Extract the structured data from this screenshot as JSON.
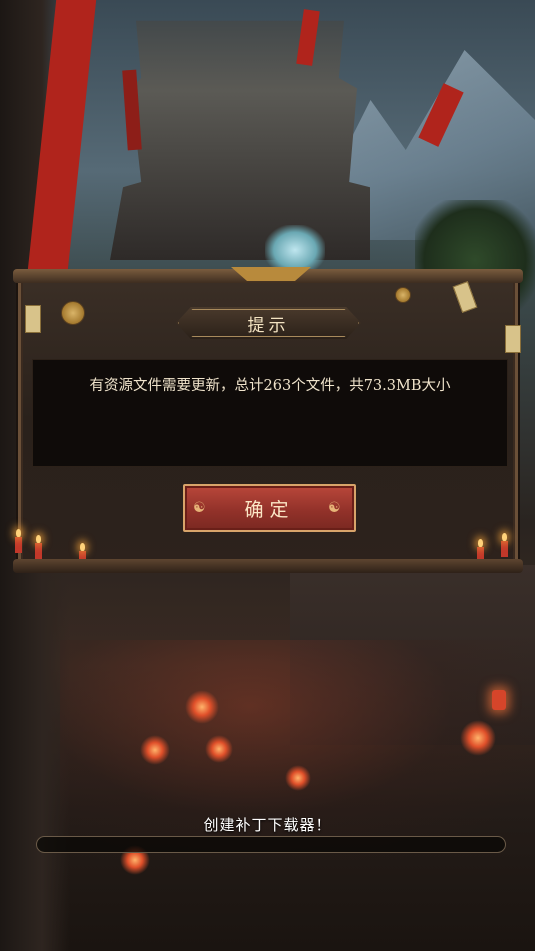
{
  "dialog": {
    "title": "提示",
    "message": "有资源文件需要更新，总计263个文件，共73.3MB大小",
    "confirm_label": "确定"
  },
  "status": {
    "text": "创建补丁下载器！"
  },
  "progress": {
    "value": 0
  },
  "colors": {
    "accent_red": "#b9473a",
    "frame_gold": "#d8a46a",
    "text_cream": "#f0e4cc"
  }
}
